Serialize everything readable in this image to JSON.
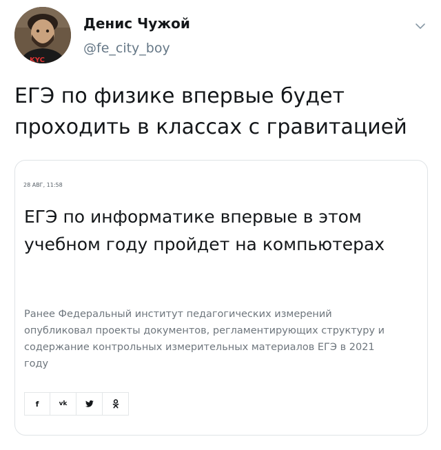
{
  "author": {
    "display_name": "Денис Чужой",
    "handle": "@fe_city_boy",
    "avatar_shirt_text": "KYC"
  },
  "tweet": {
    "text": "ЕГЭ по физике впервые будет проходить в классах с гравитацией"
  },
  "card": {
    "date": "28 АВГ, 11:58",
    "title": "ЕГЭ по информатике впервые в этом учебном году пройдет на компьютерах",
    "description": "Ранее Федеральный институт педагогических измерений опубликовал проекты документов, регламентирующих структуру и содержание контрольных измерительных материалов ЕГЭ в 2021 году",
    "share_buttons": [
      {
        "label": "f",
        "icon": "facebook-icon"
      },
      {
        "label": "vk",
        "icon": "vk-icon"
      },
      {
        "label": "",
        "icon": "twitter-icon"
      },
      {
        "label": "",
        "icon": "odnoklassniki-icon"
      }
    ]
  },
  "colors": {
    "name": "#14171a",
    "handle": "#657786",
    "card_border": "#dfe3e6",
    "description": "#6e767d"
  }
}
